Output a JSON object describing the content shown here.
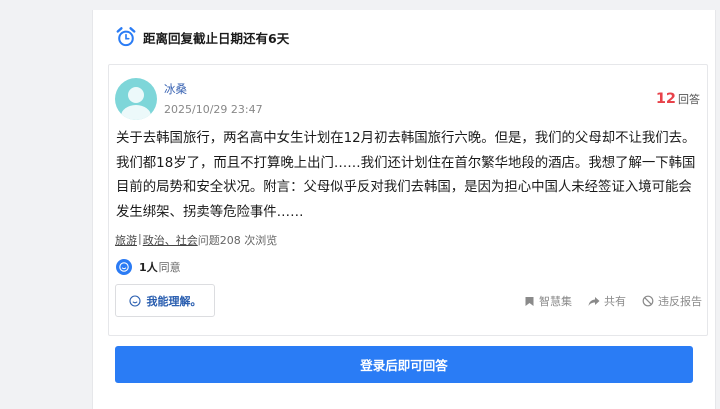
{
  "deadline": {
    "text": "距离回复截止日期还有6天"
  },
  "question": {
    "user_name": "冰桑",
    "date": "2025/10/29 23:47",
    "answer_count": "12",
    "answer_label": "回答",
    "text": "关于去韩国旅行，两名高中女生计划在12月初去韩国旅行六晚。但是，我们的父母却不让我们去。我们都18岁了，而且不打算晚上出门……我们还计划住在首尔繁华地段的酒店。我想了解一下韩国目前的局势和安全状况。附言：父母似乎反对我们去韩国，是因为担心中国人未经签证入境可能会发生绑架、拐卖等危险事件……",
    "tags": [
      "旅游",
      "政治、社会"
    ],
    "separator": "|",
    "views": "问题208 次浏览",
    "agree_count": "1人",
    "agree_label": "同意",
    "understand_label": "我能理解。",
    "actions": {
      "wisdom": "智慧集",
      "share": "共有",
      "report": "违反报告"
    }
  },
  "login_button": "登录后即可回答",
  "colors": {
    "accent": "#2a7cf5",
    "answer_count": "#e8424a",
    "avatar": "#7ed6d9"
  },
  "icons": [
    "alarm-clock-icon",
    "smile-icon",
    "bookmark-icon",
    "share-arrow-icon",
    "prohibited-icon"
  ]
}
